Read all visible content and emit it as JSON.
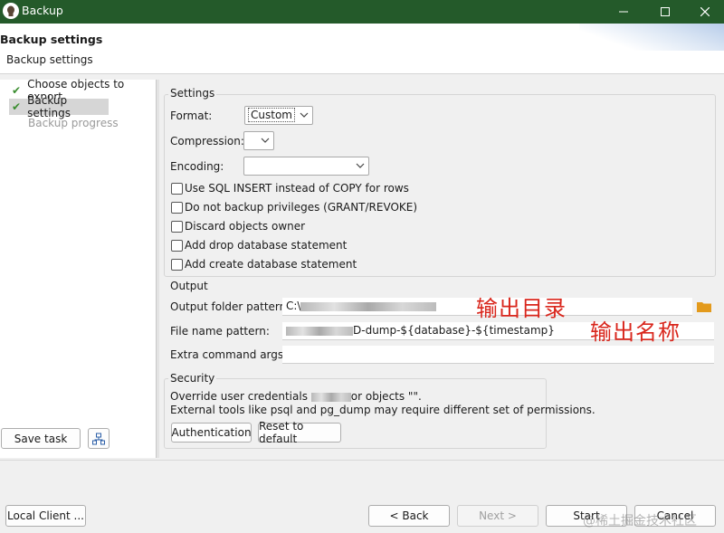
{
  "window": {
    "title": "Backup"
  },
  "header": {
    "title": "Backup settings",
    "subtitle": "Backup settings"
  },
  "steps": [
    {
      "label": "Choose objects to export",
      "done": true
    },
    {
      "label": "Backup settings",
      "done": true
    },
    {
      "label": "Backup progress",
      "done": false
    }
  ],
  "left_buttons": {
    "save_task": "Save task"
  },
  "settings": {
    "legend": "Settings",
    "format_label": "Format:",
    "format_value": "Custom",
    "compression_label": "Compression:",
    "compression_value": "",
    "encoding_label": "Encoding:",
    "encoding_value": "",
    "options": [
      {
        "label": "Use SQL INSERT instead of COPY for rows",
        "checked": false
      },
      {
        "label": "Do not backup privileges (GRANT/REVOKE)",
        "checked": false
      },
      {
        "label": "Discard objects owner",
        "checked": false
      },
      {
        "label": "Add drop database statement",
        "checked": false
      },
      {
        "label": "Add create database statement",
        "checked": false
      }
    ]
  },
  "output": {
    "legend": "Output",
    "folder_label": "Output folder pattern:",
    "folder_value": "C:\\",
    "file_label": "File name pattern:",
    "file_value": "D-dump-${database}-${timestamp}",
    "extra_label": "Extra command args:",
    "extra_value": "",
    "annotation_folder": "输出目录",
    "annotation_file": "输出名称"
  },
  "security": {
    "legend": "Security",
    "line1_a": "Override user credentials",
    "line1_b": "or objects \"\".",
    "line2": "External tools like psql and pg_dump may require different set of permissions.",
    "auth_button": "Authentication",
    "reset_button": "Reset to default"
  },
  "footer": {
    "local_client": "Local Client ...",
    "back": "< Back",
    "next": "Next >",
    "start": "Start",
    "cancel": "Cancel",
    "watermark": "@稀土掘金技术社区"
  },
  "colors": {
    "titlebar": "#245a2a",
    "check": "#3a8d2f",
    "annotation": "#d9261c",
    "folder_icon": "#e39a1c"
  }
}
